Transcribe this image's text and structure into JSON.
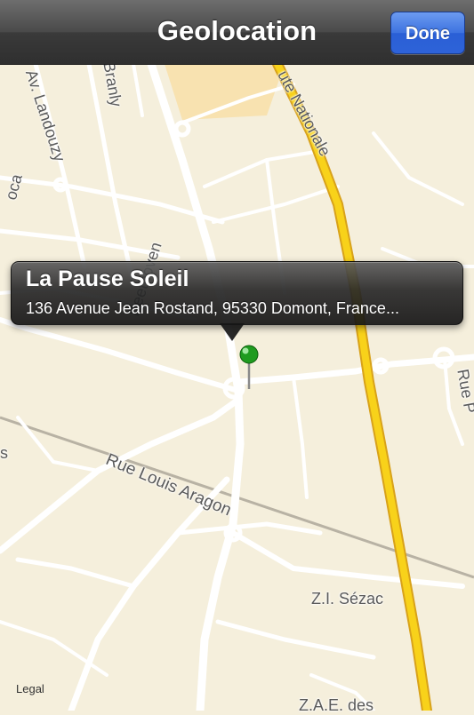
{
  "navbar": {
    "title": "Geolocation",
    "done_label": "Done"
  },
  "callout": {
    "title": "La Pause Soleil",
    "address": "136 Avenue Jean Rostand, 95330 Domont, France..."
  },
  "map": {
    "legal": "Legal",
    "labels": {
      "av_landouzy": "Av. Landouzy",
      "branly": "Branly",
      "route_nationale": "ute Nationale",
      "oca": "oca",
      "beethoven": "Beethoven",
      "rue_louis_aragon": "Rue Louis Aragon",
      "zi_sezac": "Z.I. Sézac",
      "zae_des": "Z.A.E. des",
      "rue_p": "Rue P",
      "s": "s"
    },
    "colors": {
      "land": "#f5efdc",
      "road": "#ffffff",
      "highway": "#f8d21a",
      "pin": "#1f9b1f"
    }
  }
}
